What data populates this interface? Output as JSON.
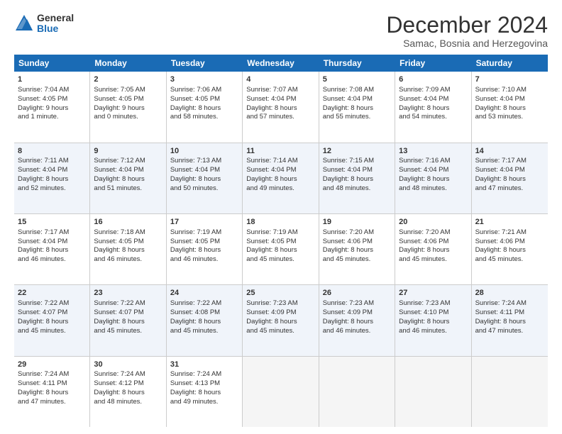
{
  "header": {
    "logo_general": "General",
    "logo_blue": "Blue",
    "main_title": "December 2024",
    "subtitle": "Samac, Bosnia and Herzegovina"
  },
  "days_of_week": [
    "Sunday",
    "Monday",
    "Tuesday",
    "Wednesday",
    "Thursday",
    "Friday",
    "Saturday"
  ],
  "weeks": [
    [
      {
        "day": 1,
        "lines": [
          "Sunrise: 7:04 AM",
          "Sunset: 4:05 PM",
          "Daylight: 9 hours",
          "and 1 minute."
        ]
      },
      {
        "day": 2,
        "lines": [
          "Sunrise: 7:05 AM",
          "Sunset: 4:05 PM",
          "Daylight: 9 hours",
          "and 0 minutes."
        ]
      },
      {
        "day": 3,
        "lines": [
          "Sunrise: 7:06 AM",
          "Sunset: 4:05 PM",
          "Daylight: 8 hours",
          "and 58 minutes."
        ]
      },
      {
        "day": 4,
        "lines": [
          "Sunrise: 7:07 AM",
          "Sunset: 4:04 PM",
          "Daylight: 8 hours",
          "and 57 minutes."
        ]
      },
      {
        "day": 5,
        "lines": [
          "Sunrise: 7:08 AM",
          "Sunset: 4:04 PM",
          "Daylight: 8 hours",
          "and 55 minutes."
        ]
      },
      {
        "day": 6,
        "lines": [
          "Sunrise: 7:09 AM",
          "Sunset: 4:04 PM",
          "Daylight: 8 hours",
          "and 54 minutes."
        ]
      },
      {
        "day": 7,
        "lines": [
          "Sunrise: 7:10 AM",
          "Sunset: 4:04 PM",
          "Daylight: 8 hours",
          "and 53 minutes."
        ]
      }
    ],
    [
      {
        "day": 8,
        "lines": [
          "Sunrise: 7:11 AM",
          "Sunset: 4:04 PM",
          "Daylight: 8 hours",
          "and 52 minutes."
        ]
      },
      {
        "day": 9,
        "lines": [
          "Sunrise: 7:12 AM",
          "Sunset: 4:04 PM",
          "Daylight: 8 hours",
          "and 51 minutes."
        ]
      },
      {
        "day": 10,
        "lines": [
          "Sunrise: 7:13 AM",
          "Sunset: 4:04 PM",
          "Daylight: 8 hours",
          "and 50 minutes."
        ]
      },
      {
        "day": 11,
        "lines": [
          "Sunrise: 7:14 AM",
          "Sunset: 4:04 PM",
          "Daylight: 8 hours",
          "and 49 minutes."
        ]
      },
      {
        "day": 12,
        "lines": [
          "Sunrise: 7:15 AM",
          "Sunset: 4:04 PM",
          "Daylight: 8 hours",
          "and 48 minutes."
        ]
      },
      {
        "day": 13,
        "lines": [
          "Sunrise: 7:16 AM",
          "Sunset: 4:04 PM",
          "Daylight: 8 hours",
          "and 48 minutes."
        ]
      },
      {
        "day": 14,
        "lines": [
          "Sunrise: 7:17 AM",
          "Sunset: 4:04 PM",
          "Daylight: 8 hours",
          "and 47 minutes."
        ]
      }
    ],
    [
      {
        "day": 15,
        "lines": [
          "Sunrise: 7:17 AM",
          "Sunset: 4:04 PM",
          "Daylight: 8 hours",
          "and 46 minutes."
        ]
      },
      {
        "day": 16,
        "lines": [
          "Sunrise: 7:18 AM",
          "Sunset: 4:05 PM",
          "Daylight: 8 hours",
          "and 46 minutes."
        ]
      },
      {
        "day": 17,
        "lines": [
          "Sunrise: 7:19 AM",
          "Sunset: 4:05 PM",
          "Daylight: 8 hours",
          "and 46 minutes."
        ]
      },
      {
        "day": 18,
        "lines": [
          "Sunrise: 7:19 AM",
          "Sunset: 4:05 PM",
          "Daylight: 8 hours",
          "and 45 minutes."
        ]
      },
      {
        "day": 19,
        "lines": [
          "Sunrise: 7:20 AM",
          "Sunset: 4:06 PM",
          "Daylight: 8 hours",
          "and 45 minutes."
        ]
      },
      {
        "day": 20,
        "lines": [
          "Sunrise: 7:20 AM",
          "Sunset: 4:06 PM",
          "Daylight: 8 hours",
          "and 45 minutes."
        ]
      },
      {
        "day": 21,
        "lines": [
          "Sunrise: 7:21 AM",
          "Sunset: 4:06 PM",
          "Daylight: 8 hours",
          "and 45 minutes."
        ]
      }
    ],
    [
      {
        "day": 22,
        "lines": [
          "Sunrise: 7:22 AM",
          "Sunset: 4:07 PM",
          "Daylight: 8 hours",
          "and 45 minutes."
        ]
      },
      {
        "day": 23,
        "lines": [
          "Sunrise: 7:22 AM",
          "Sunset: 4:07 PM",
          "Daylight: 8 hours",
          "and 45 minutes."
        ]
      },
      {
        "day": 24,
        "lines": [
          "Sunrise: 7:22 AM",
          "Sunset: 4:08 PM",
          "Daylight: 8 hours",
          "and 45 minutes."
        ]
      },
      {
        "day": 25,
        "lines": [
          "Sunrise: 7:23 AM",
          "Sunset: 4:09 PM",
          "Daylight: 8 hours",
          "and 45 minutes."
        ]
      },
      {
        "day": 26,
        "lines": [
          "Sunrise: 7:23 AM",
          "Sunset: 4:09 PM",
          "Daylight: 8 hours",
          "and 46 minutes."
        ]
      },
      {
        "day": 27,
        "lines": [
          "Sunrise: 7:23 AM",
          "Sunset: 4:10 PM",
          "Daylight: 8 hours",
          "and 46 minutes."
        ]
      },
      {
        "day": 28,
        "lines": [
          "Sunrise: 7:24 AM",
          "Sunset: 4:11 PM",
          "Daylight: 8 hours",
          "and 47 minutes."
        ]
      }
    ],
    [
      {
        "day": 29,
        "lines": [
          "Sunrise: 7:24 AM",
          "Sunset: 4:11 PM",
          "Daylight: 8 hours",
          "and 47 minutes."
        ]
      },
      {
        "day": 30,
        "lines": [
          "Sunrise: 7:24 AM",
          "Sunset: 4:12 PM",
          "Daylight: 8 hours",
          "and 48 minutes."
        ]
      },
      {
        "day": 31,
        "lines": [
          "Sunrise: 7:24 AM",
          "Sunset: 4:13 PM",
          "Daylight: 8 hours",
          "and 49 minutes."
        ]
      },
      null,
      null,
      null,
      null
    ]
  ]
}
